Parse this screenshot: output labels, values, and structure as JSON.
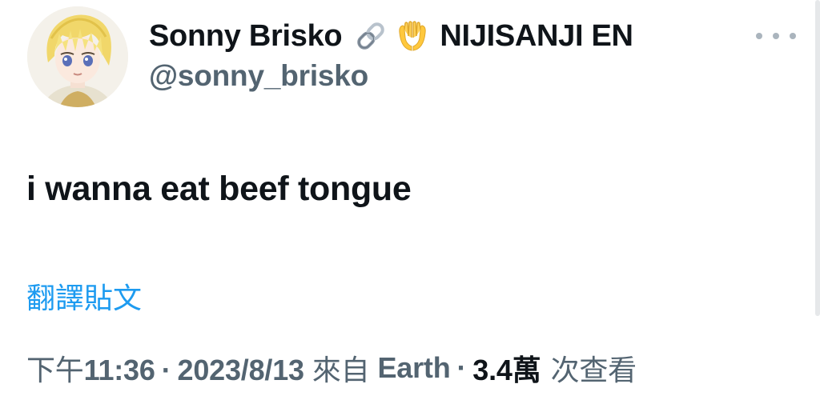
{
  "author": {
    "display_name": "Sonny Brisko",
    "name_emojis": [
      "link-emoji",
      "palms-up-together-emoji"
    ],
    "name_suffix": "NIJISANJI EN",
    "handle": "@sonny_brisko"
  },
  "tweet": {
    "text": "i wanna eat beef tongue",
    "translate_label": "翻譯貼文"
  },
  "meta": {
    "time_prefix": "下午",
    "time": "11:36",
    "separator": "·",
    "date": "2023/8/13",
    "from_label": "來自",
    "source": "Earth",
    "views_number": "3.4",
    "views_unit": "萬",
    "views_label": "次查看"
  },
  "colors": {
    "text_primary": "#0f1419",
    "text_secondary": "#536471",
    "link": "#1d9bf0",
    "background": "#ffffff"
  }
}
